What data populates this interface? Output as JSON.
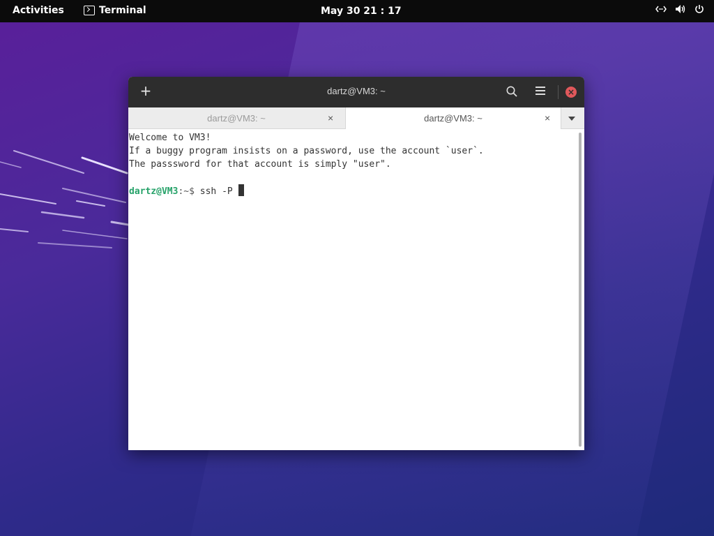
{
  "topbar": {
    "activities": "Activities",
    "app_name": "Terminal",
    "clock": "May 30  21 : 17"
  },
  "window": {
    "title": "dartz@VM3: ~",
    "tabs": [
      {
        "label": "dartz@VM3: ~",
        "active": false
      },
      {
        "label": "dartz@VM3: ~",
        "active": true
      }
    ],
    "tab_close_glyph": "×"
  },
  "terminal": {
    "lines": [
      "Welcome to VM3!",
      "If a buggy program insists on a password, use the account `user`.",
      "The passsword for that account is simply \"user\"."
    ],
    "prompt_user": "dartz@VM3",
    "prompt_path": ":~$",
    "command": " ssh -P "
  },
  "icons": {
    "add": "plus-icon",
    "search": "search-icon",
    "menu": "hamburger-menu-icon",
    "close": "close-icon",
    "network": "network-icon",
    "volume": "volume-icon",
    "power": "power-icon"
  },
  "colors": {
    "prompt_user": "#26a269",
    "close_button": "#e0585b",
    "headerbar": "#2d2d2d"
  }
}
